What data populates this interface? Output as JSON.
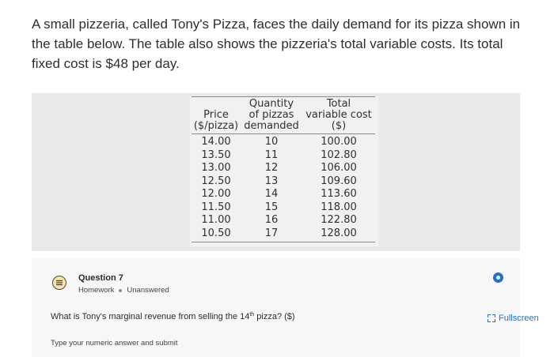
{
  "intro": {
    "text": "A small pizzeria, called Tony's Pizza, faces the daily demand for its pizza shown in the table below. The table also shows the pizzeria's total variable costs. Its total fixed cost is $48 per day."
  },
  "table": {
    "headers": {
      "price": [
        "Price",
        "($/pizza)"
      ],
      "quantity": [
        "Quantity",
        "of pizzas",
        "demanded"
      ],
      "tvc": [
        "Total",
        "variable cost",
        "($)"
      ]
    },
    "rows": [
      [
        "14.00",
        "10",
        "100.00"
      ],
      [
        "13.50",
        "11",
        "102.80"
      ],
      [
        "13.00",
        "12",
        "106.00"
      ],
      [
        "12.50",
        "13",
        "109.60"
      ],
      [
        "12.00",
        "14",
        "113.60"
      ],
      [
        "11.50",
        "15",
        "118.00"
      ],
      [
        "11.00",
        "16",
        "122.80"
      ],
      [
        "10.50",
        "17",
        "128.00"
      ]
    ]
  },
  "question": {
    "title": "Question 7",
    "type": "Homework",
    "status": "Unanswered",
    "text_before": "What is Tony's marginal revenue from selling the 14",
    "ordinal": "th",
    "text_after": " pizza? ($)",
    "answer_hint": "Type your numeric answer and submit",
    "fullscreen_label": "Fullscreen",
    "icon": "list-question-icon",
    "info_icon": "info-icon",
    "fullscreen_icon": "fullscreen-icon",
    "accent_color": "#1f6fd4"
  }
}
